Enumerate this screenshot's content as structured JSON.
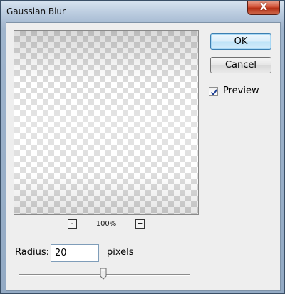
{
  "window": {
    "title": "Gaussian Blur",
    "close_label": "X"
  },
  "preview": {
    "zoom_minus_label": "-",
    "zoom_level": "100%",
    "zoom_plus_label": "+"
  },
  "buttons": {
    "ok_label": "OK",
    "cancel_label": "Cancel"
  },
  "preview_option": {
    "label": "Preview",
    "checked": true
  },
  "radius": {
    "label": "Radius:",
    "value": "20",
    "unit": "pixels"
  },
  "slider": {
    "value_fraction": 0.49
  }
}
